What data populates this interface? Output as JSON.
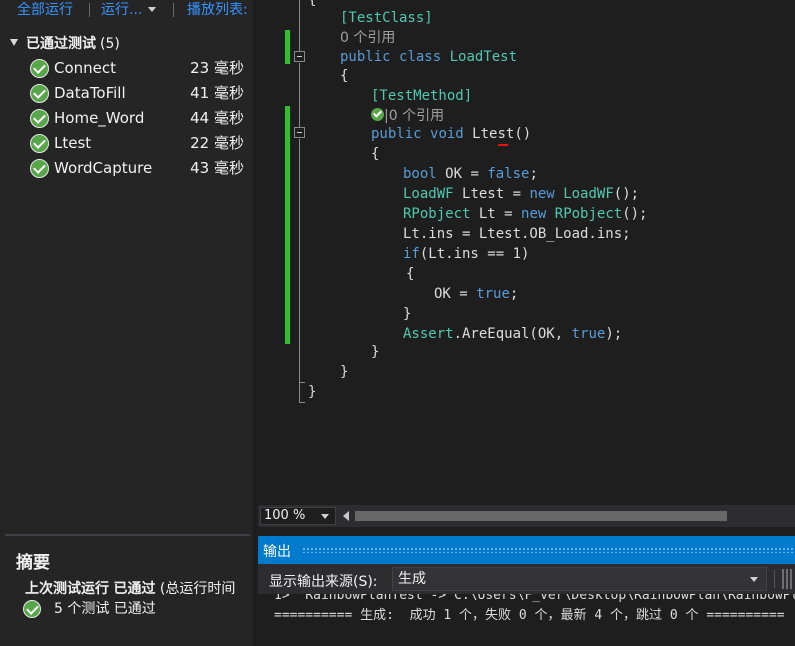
{
  "toolbar": {
    "run_all": "全部运行",
    "run": "运行...",
    "playlist": "播放列表:"
  },
  "tests": {
    "group_label": "已通过测试",
    "group_count": "(5)",
    "items": [
      {
        "name": "Connect",
        "time": "23 毫秒"
      },
      {
        "name": "DataToFill",
        "time": "41 毫秒"
      },
      {
        "name": "Home_Word",
        "time": "44 毫秒"
      },
      {
        "name": "Ltest",
        "time": "22 毫秒"
      },
      {
        "name": "WordCapture",
        "time": "43 毫秒"
      }
    ]
  },
  "summary": {
    "title": "摘要",
    "last_run_prefix": "上次测试运行",
    "last_run_status": "已通过",
    "last_run_suffix": "(总运行时间",
    "passed_text": "5 个测试 已通过"
  },
  "code": {
    "brace_top": "{",
    "attr_class": "[TestClass]",
    "refs_class": "0 个引用",
    "kw_public": "public",
    "kw_class": "class",
    "class_name": "LoadTest",
    "brace_open": "{",
    "attr_method": "[TestMethod]",
    "refs_method": "|0 个引用",
    "kw_void": "void",
    "method_sig": "Ltest()",
    "line_bool_type": "bool",
    "line_bool_rest": "OK = ",
    "kw_false": "false",
    "semi": ";",
    "type_loadwf": "LoadWF",
    "line_loadwf_rest": "Ltest = ",
    "kw_new": "new",
    "call_loadwf": "();",
    "type_rpobject": "RPobject",
    "line_rp_rest": "Lt = ",
    "call_rp": "();",
    "line_assign": "Lt.ins = Ltest.OB_Load.ins;",
    "kw_if": "if",
    "if_cond": "(Lt.ins == 1)",
    "ok_assign": "OK = ",
    "kw_true": "true",
    "type_assert": "Assert",
    "assert_call": ".AreEqual(OK, ",
    "assert_end": ");",
    "brace_close": "}"
  },
  "editor": {
    "zoom": "100 %"
  },
  "output": {
    "title": "输出",
    "source_label": "显示输出来源(S):",
    "source_value": "生成",
    "line1": "1>  RainbowPlanTest -> C:\\Users\\F_ver\\Desktop\\RainbowPlan\\RainbowPl",
    "line2": "========== 生成:  成功 1 个，失败 0 个，最新 4 个，跳过 0 个 =========="
  }
}
